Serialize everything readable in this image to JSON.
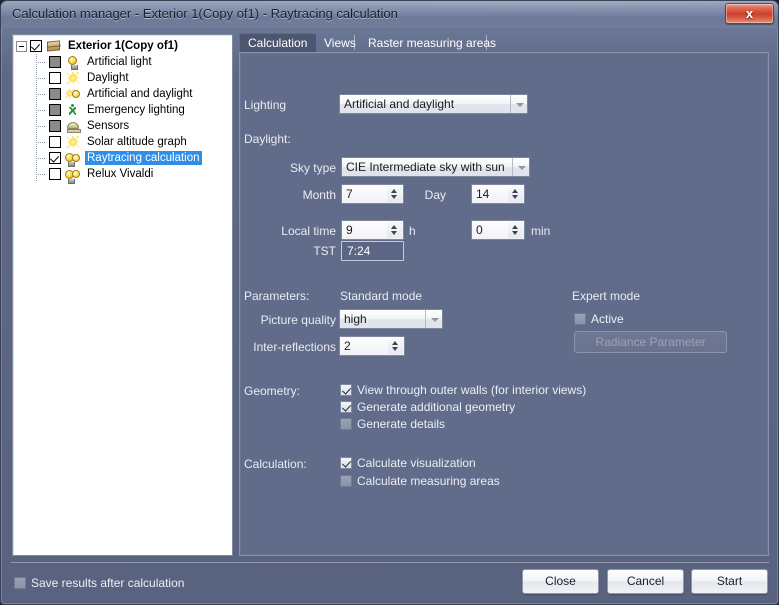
{
  "window": {
    "title": "Calculation manager - Exterior 1(Copy of1)  - Raytracing calculation",
    "close_label": "x"
  },
  "tree": {
    "root": {
      "label": "Exterior 1(Copy of1)",
      "icon": "package-icon",
      "checked": true,
      "expanded": true
    },
    "items": [
      {
        "label": "Artificial light",
        "icon": "bulb-icon",
        "state": "gray"
      },
      {
        "label": "Daylight",
        "icon": "sun-icon",
        "state": "empty"
      },
      {
        "label": "Artificial and daylight",
        "icon": "bulb-and-sun-icon",
        "state": "gray"
      },
      {
        "label": "Emergency lighting",
        "icon": "running-man-icon",
        "state": "gray"
      },
      {
        "label": "Sensors",
        "icon": "sensor-icon",
        "state": "gray"
      },
      {
        "label": "Solar altitude graph",
        "icon": "sun-icon",
        "state": "empty"
      },
      {
        "label": "Raytracing calculation",
        "icon": "bulb-pair-icon",
        "state": "checked",
        "selected": true
      },
      {
        "label": "Relux Vivaldi",
        "icon": "bulb-pair-icon",
        "state": "empty"
      }
    ]
  },
  "tabs": [
    {
      "label": "Calculation",
      "active": true
    },
    {
      "label": "Views",
      "active": false
    },
    {
      "label": "Raster measuring areas",
      "active": false
    }
  ],
  "form": {
    "lighting": {
      "label": "Lighting",
      "value": "Artificial and daylight"
    },
    "daylight": {
      "group_label": "Daylight:",
      "sky_type": {
        "label": "Sky type",
        "value": "CIE Intermediate sky with sun"
      },
      "month": {
        "label": "Month",
        "value": "7"
      },
      "day": {
        "label": "Day",
        "value": "14"
      },
      "local_time": {
        "label": "Local time",
        "value": "9",
        "unit": "h"
      },
      "minutes": {
        "value": "0",
        "unit": "min"
      },
      "tst": {
        "label": "TST",
        "value": "7:24"
      }
    },
    "parameters": {
      "group_label": "Parameters:",
      "standard_mode_label": "Standard mode",
      "expert_mode_label": "Expert mode",
      "picture_quality": {
        "label": "Picture quality",
        "value": "high"
      },
      "inter_reflections": {
        "label": "Inter-reflections",
        "value": "2"
      },
      "active": {
        "label": "Active",
        "checked": false
      },
      "radiance_parameter_button": {
        "label": "Radiance Parameter",
        "disabled": true
      }
    },
    "geometry": {
      "group_label": "Geometry:",
      "options": [
        {
          "label": "View through outer walls (for interior views)",
          "checked": true
        },
        {
          "label": "Generate additional geometry",
          "checked": true
        },
        {
          "label": "Generate details",
          "checked": false
        }
      ]
    },
    "calculation": {
      "group_label": "Calculation:",
      "options": [
        {
          "label": "Calculate visualization",
          "checked": true
        },
        {
          "label": "Calculate measuring areas",
          "checked": false
        }
      ]
    }
  },
  "footer": {
    "save_results": {
      "label": "Save results after calculation",
      "checked": false
    },
    "buttons": [
      {
        "label": "Close"
      },
      {
        "label": "Cancel"
      },
      {
        "label": "Start"
      }
    ]
  },
  "colors": {
    "panel_bg": "#616b8a",
    "window_bg": "#5d6884",
    "selection": "#2f8fe8",
    "close_red": "#c8402c"
  }
}
